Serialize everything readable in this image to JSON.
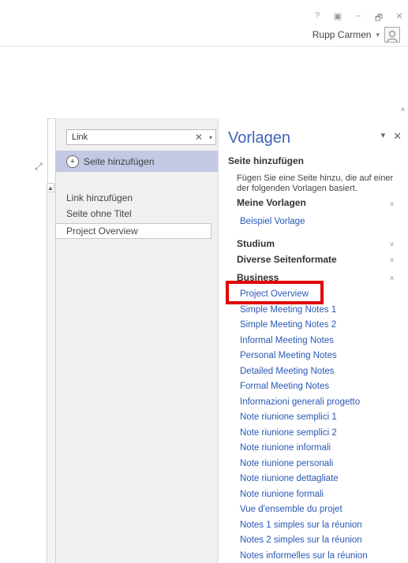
{
  "window": {
    "controls": [
      "?",
      "▣",
      "–",
      "🗗",
      "✕"
    ],
    "user_name": "Rupp Carmen",
    "user_dropdown": "▾"
  },
  "search": {
    "value": "Link",
    "clear": "✕",
    "dropdown": "▾"
  },
  "pages": {
    "add_page_label": "Seite hinzufügen",
    "items": [
      "Link hinzufügen",
      "Seite ohne Titel",
      "Project Overview"
    ]
  },
  "templates": {
    "title": "Vorlagen",
    "add_page_heading": "Seite hinzufügen",
    "description": "Fügen Sie eine Seite hinzu, die auf einer der folgenden Vorlagen basiert.",
    "my_templates_heading": "Meine Vorlagen",
    "my_templates_items": [
      "Beispiel Vorlage"
    ],
    "groups": [
      "Studium",
      "Diverse Seitenformate",
      "Business"
    ],
    "business_items": [
      "Project Overview",
      "Simple Meeting Notes 1",
      "Simple Meeting Notes 2",
      "Informal Meeting Notes",
      "Personal Meeting Notes",
      "Detailed Meeting Notes",
      "Formal Meeting Notes",
      "Informazioni generali progetto",
      "Note riunione semplici 1",
      "Note riunione semplici 2",
      "Note riunione informali",
      "Note riunione personali",
      "Note riunione dettagliate",
      "Note riunione formali",
      "Vue d'ensemble du projet",
      "Notes 1 simples sur la réunion",
      "Notes 2 simples sur la réunion",
      "Notes informelles sur la réunion"
    ]
  }
}
